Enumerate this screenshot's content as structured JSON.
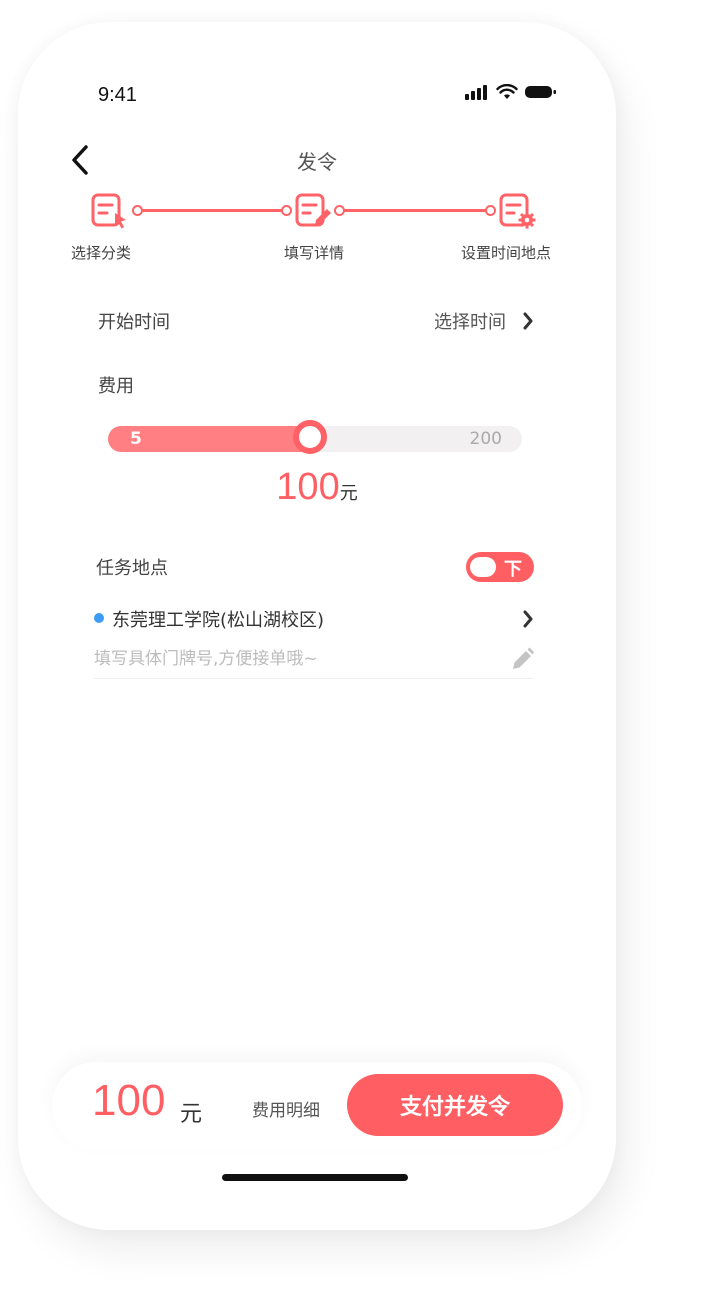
{
  "status_bar": {
    "time": "9:41"
  },
  "nav": {
    "title": "发令"
  },
  "stepper": {
    "steps": [
      {
        "label": "选择分类"
      },
      {
        "label": "填写详情"
      },
      {
        "label": "设置时间地点"
      }
    ]
  },
  "start_time": {
    "label": "开始时间",
    "value": "选择时间"
  },
  "fee": {
    "label": "费用",
    "slider_min": "5",
    "slider_max": "200",
    "current": 100,
    "amount": "100",
    "unit": "元"
  },
  "location": {
    "label": "任务地点",
    "toggle_text": "下",
    "address": "东莞理工学院(松山湖校区)",
    "detail_placeholder": "填写具体门牌号,方便接单哦~"
  },
  "bottom": {
    "total": "100",
    "unit": "元",
    "detail_label": "费用明细",
    "pay_label": "支付并发令"
  },
  "colors": {
    "accent": "#ff5f63",
    "slider_fill": "#ff7f82",
    "location_dot": "#3d9cf5"
  }
}
